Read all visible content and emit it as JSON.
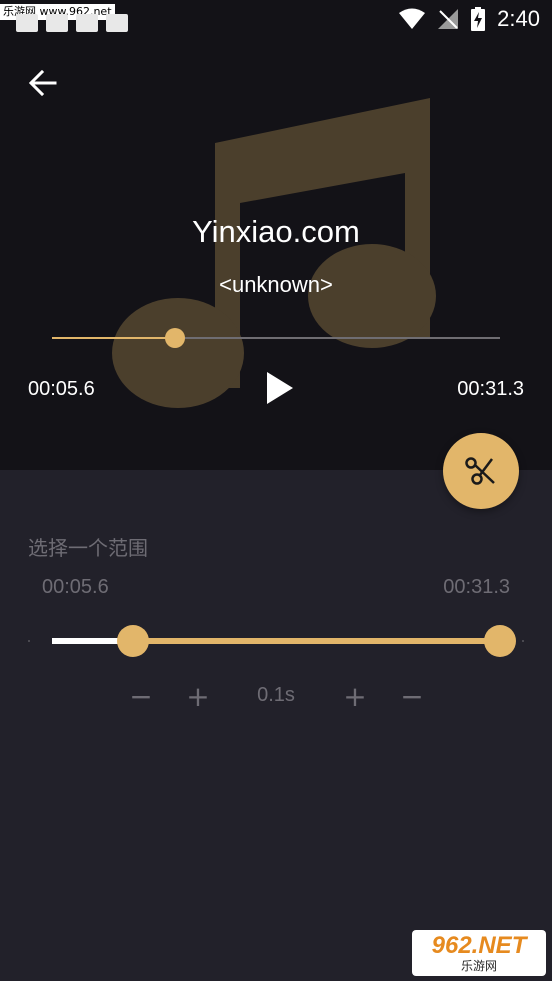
{
  "status_bar": {
    "watermark_text": "乐游网 www.962.net",
    "time": "2:40"
  },
  "player": {
    "title": "Yinxiao.com",
    "artist": "<unknown>",
    "current_time": "00:05.6",
    "total_time": "00:31.3",
    "progress": 0.274
  },
  "range": {
    "label": "选择一个范围",
    "start_time": "00:05.6",
    "end_time": "00:31.3",
    "start_fraction": 0.18,
    "end_fraction": 1.0,
    "step_value": "0.1s",
    "minus": "−",
    "plus": "+"
  },
  "watermark": {
    "brand": "962.NET",
    "sub": "乐游网"
  },
  "colors": {
    "accent": "#e2b66a",
    "background": "#22212a",
    "player_bg": "#131217",
    "muted_text": "#6e6c74"
  }
}
